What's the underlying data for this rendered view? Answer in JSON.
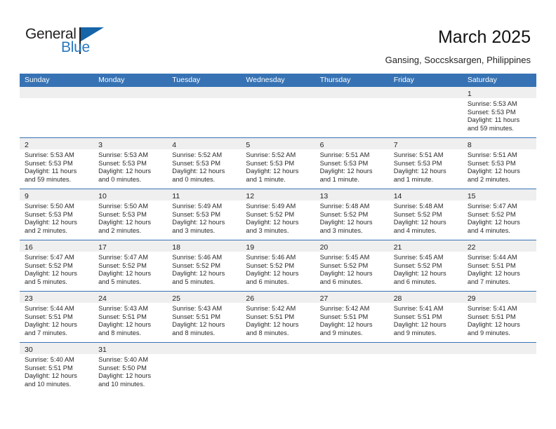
{
  "brand": {
    "name_line1": "General",
    "name_line2": "Blue",
    "flag_icon": "triangle-flag-icon",
    "primary_color": "#2878bd",
    "flag_color": "#1565a8"
  },
  "header": {
    "title": "March 2025",
    "subtitle": "Gansing, Soccsksargen, Philippines"
  },
  "calendar": {
    "header_bg": "#3773b4",
    "daynum_bg": "#efefef",
    "weekdays": [
      "Sunday",
      "Monday",
      "Tuesday",
      "Wednesday",
      "Thursday",
      "Friday",
      "Saturday"
    ],
    "weeks": [
      [
        {
          "day": "",
          "empty": true
        },
        {
          "day": "",
          "empty": true
        },
        {
          "day": "",
          "empty": true
        },
        {
          "day": "",
          "empty": true
        },
        {
          "day": "",
          "empty": true
        },
        {
          "day": "",
          "empty": true
        },
        {
          "day": "1",
          "sunrise": "Sunrise: 5:53 AM",
          "sunset": "Sunset: 5:53 PM",
          "daylight1": "Daylight: 11 hours",
          "daylight2": "and 59 minutes."
        }
      ],
      [
        {
          "day": "2",
          "sunrise": "Sunrise: 5:53 AM",
          "sunset": "Sunset: 5:53 PM",
          "daylight1": "Daylight: 11 hours",
          "daylight2": "and 59 minutes."
        },
        {
          "day": "3",
          "sunrise": "Sunrise: 5:53 AM",
          "sunset": "Sunset: 5:53 PM",
          "daylight1": "Daylight: 12 hours",
          "daylight2": "and 0 minutes."
        },
        {
          "day": "4",
          "sunrise": "Sunrise: 5:52 AM",
          "sunset": "Sunset: 5:53 PM",
          "daylight1": "Daylight: 12 hours",
          "daylight2": "and 0 minutes."
        },
        {
          "day": "5",
          "sunrise": "Sunrise: 5:52 AM",
          "sunset": "Sunset: 5:53 PM",
          "daylight1": "Daylight: 12 hours",
          "daylight2": "and 1 minute."
        },
        {
          "day": "6",
          "sunrise": "Sunrise: 5:51 AM",
          "sunset": "Sunset: 5:53 PM",
          "daylight1": "Daylight: 12 hours",
          "daylight2": "and 1 minute."
        },
        {
          "day": "7",
          "sunrise": "Sunrise: 5:51 AM",
          "sunset": "Sunset: 5:53 PM",
          "daylight1": "Daylight: 12 hours",
          "daylight2": "and 1 minute."
        },
        {
          "day": "8",
          "sunrise": "Sunrise: 5:51 AM",
          "sunset": "Sunset: 5:53 PM",
          "daylight1": "Daylight: 12 hours",
          "daylight2": "and 2 minutes."
        }
      ],
      [
        {
          "day": "9",
          "sunrise": "Sunrise: 5:50 AM",
          "sunset": "Sunset: 5:53 PM",
          "daylight1": "Daylight: 12 hours",
          "daylight2": "and 2 minutes."
        },
        {
          "day": "10",
          "sunrise": "Sunrise: 5:50 AM",
          "sunset": "Sunset: 5:53 PM",
          "daylight1": "Daylight: 12 hours",
          "daylight2": "and 2 minutes."
        },
        {
          "day": "11",
          "sunrise": "Sunrise: 5:49 AM",
          "sunset": "Sunset: 5:53 PM",
          "daylight1": "Daylight: 12 hours",
          "daylight2": "and 3 minutes."
        },
        {
          "day": "12",
          "sunrise": "Sunrise: 5:49 AM",
          "sunset": "Sunset: 5:52 PM",
          "daylight1": "Daylight: 12 hours",
          "daylight2": "and 3 minutes."
        },
        {
          "day": "13",
          "sunrise": "Sunrise: 5:48 AM",
          "sunset": "Sunset: 5:52 PM",
          "daylight1": "Daylight: 12 hours",
          "daylight2": "and 3 minutes."
        },
        {
          "day": "14",
          "sunrise": "Sunrise: 5:48 AM",
          "sunset": "Sunset: 5:52 PM",
          "daylight1": "Daylight: 12 hours",
          "daylight2": "and 4 minutes."
        },
        {
          "day": "15",
          "sunrise": "Sunrise: 5:47 AM",
          "sunset": "Sunset: 5:52 PM",
          "daylight1": "Daylight: 12 hours",
          "daylight2": "and 4 minutes."
        }
      ],
      [
        {
          "day": "16",
          "sunrise": "Sunrise: 5:47 AM",
          "sunset": "Sunset: 5:52 PM",
          "daylight1": "Daylight: 12 hours",
          "daylight2": "and 5 minutes."
        },
        {
          "day": "17",
          "sunrise": "Sunrise: 5:47 AM",
          "sunset": "Sunset: 5:52 PM",
          "daylight1": "Daylight: 12 hours",
          "daylight2": "and 5 minutes."
        },
        {
          "day": "18",
          "sunrise": "Sunrise: 5:46 AM",
          "sunset": "Sunset: 5:52 PM",
          "daylight1": "Daylight: 12 hours",
          "daylight2": "and 5 minutes."
        },
        {
          "day": "19",
          "sunrise": "Sunrise: 5:46 AM",
          "sunset": "Sunset: 5:52 PM",
          "daylight1": "Daylight: 12 hours",
          "daylight2": "and 6 minutes."
        },
        {
          "day": "20",
          "sunrise": "Sunrise: 5:45 AM",
          "sunset": "Sunset: 5:52 PM",
          "daylight1": "Daylight: 12 hours",
          "daylight2": "and 6 minutes."
        },
        {
          "day": "21",
          "sunrise": "Sunrise: 5:45 AM",
          "sunset": "Sunset: 5:52 PM",
          "daylight1": "Daylight: 12 hours",
          "daylight2": "and 6 minutes."
        },
        {
          "day": "22",
          "sunrise": "Sunrise: 5:44 AM",
          "sunset": "Sunset: 5:51 PM",
          "daylight1": "Daylight: 12 hours",
          "daylight2": "and 7 minutes."
        }
      ],
      [
        {
          "day": "23",
          "sunrise": "Sunrise: 5:44 AM",
          "sunset": "Sunset: 5:51 PM",
          "daylight1": "Daylight: 12 hours",
          "daylight2": "and 7 minutes."
        },
        {
          "day": "24",
          "sunrise": "Sunrise: 5:43 AM",
          "sunset": "Sunset: 5:51 PM",
          "daylight1": "Daylight: 12 hours",
          "daylight2": "and 8 minutes."
        },
        {
          "day": "25",
          "sunrise": "Sunrise: 5:43 AM",
          "sunset": "Sunset: 5:51 PM",
          "daylight1": "Daylight: 12 hours",
          "daylight2": "and 8 minutes."
        },
        {
          "day": "26",
          "sunrise": "Sunrise: 5:42 AM",
          "sunset": "Sunset: 5:51 PM",
          "daylight1": "Daylight: 12 hours",
          "daylight2": "and 8 minutes."
        },
        {
          "day": "27",
          "sunrise": "Sunrise: 5:42 AM",
          "sunset": "Sunset: 5:51 PM",
          "daylight1": "Daylight: 12 hours",
          "daylight2": "and 9 minutes."
        },
        {
          "day": "28",
          "sunrise": "Sunrise: 5:41 AM",
          "sunset": "Sunset: 5:51 PM",
          "daylight1": "Daylight: 12 hours",
          "daylight2": "and 9 minutes."
        },
        {
          "day": "29",
          "sunrise": "Sunrise: 5:41 AM",
          "sunset": "Sunset: 5:51 PM",
          "daylight1": "Daylight: 12 hours",
          "daylight2": "and 9 minutes."
        }
      ],
      [
        {
          "day": "30",
          "sunrise": "Sunrise: 5:40 AM",
          "sunset": "Sunset: 5:51 PM",
          "daylight1": "Daylight: 12 hours",
          "daylight2": "and 10 minutes."
        },
        {
          "day": "31",
          "sunrise": "Sunrise: 5:40 AM",
          "sunset": "Sunset: 5:50 PM",
          "daylight1": "Daylight: 12 hours",
          "daylight2": "and 10 minutes."
        },
        {
          "day": "",
          "empty": true
        },
        {
          "day": "",
          "empty": true
        },
        {
          "day": "",
          "empty": true
        },
        {
          "day": "",
          "empty": true
        },
        {
          "day": "",
          "empty": true
        }
      ]
    ]
  }
}
